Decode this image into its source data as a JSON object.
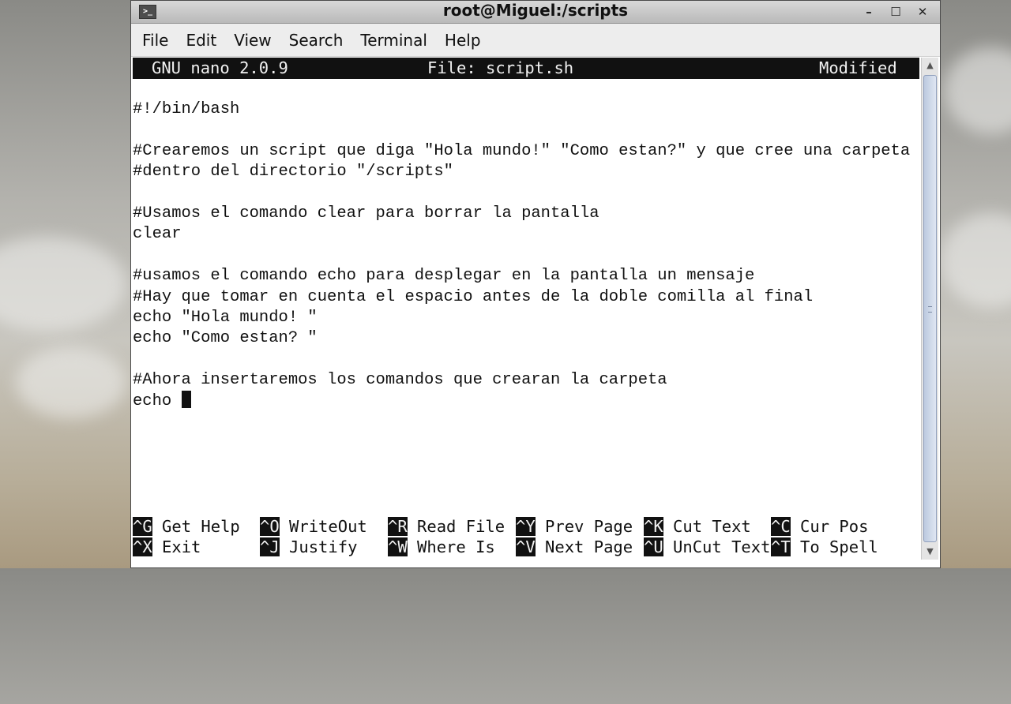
{
  "window": {
    "title": "root@Miguel:/scripts",
    "icon": "terminal-icon",
    "controls": {
      "minimize": "–",
      "maximize": "☐",
      "close": "✕"
    }
  },
  "menu": [
    "File",
    "Edit",
    "View",
    "Search",
    "Terminal",
    "Help"
  ],
  "nano": {
    "version": "GNU nano 2.0.9",
    "file": "File: script.sh",
    "status": "Modified"
  },
  "lines": [
    "#!/bin/bash",
    "",
    "#Crearemos un script que diga \"Hola mundo!\" \"Como estan?\" y que cree una carpeta",
    "#dentro del directorio \"/scripts\"",
    "",
    "#Usamos el comando clear para borrar la pantalla",
    "clear",
    "",
    "#usamos el comando echo para desplegar en la pantalla un mensaje",
    "#Hay que tomar en cuenta el espacio antes de la doble comilla al final",
    "echo \"Hola mundo! \"",
    "echo \"Como estan? \"",
    "",
    "#Ahora insertaremos los comandos que crearan la carpeta",
    "echo "
  ],
  "shortcuts": [
    [
      {
        "key": "^G",
        "label": "Get Help"
      },
      {
        "key": "^O",
        "label": "WriteOut"
      },
      {
        "key": "^R",
        "label": "Read File"
      },
      {
        "key": "^Y",
        "label": "Prev Page"
      },
      {
        "key": "^K",
        "label": "Cut Text"
      },
      {
        "key": "^C",
        "label": "Cur Pos"
      }
    ],
    [
      {
        "key": "^X",
        "label": "Exit"
      },
      {
        "key": "^J",
        "label": "Justify"
      },
      {
        "key": "^W",
        "label": "Where Is"
      },
      {
        "key": "^V",
        "label": "Next Page"
      },
      {
        "key": "^U",
        "label": "UnCut Text"
      },
      {
        "key": "^T",
        "label": "To Spell"
      }
    ]
  ]
}
